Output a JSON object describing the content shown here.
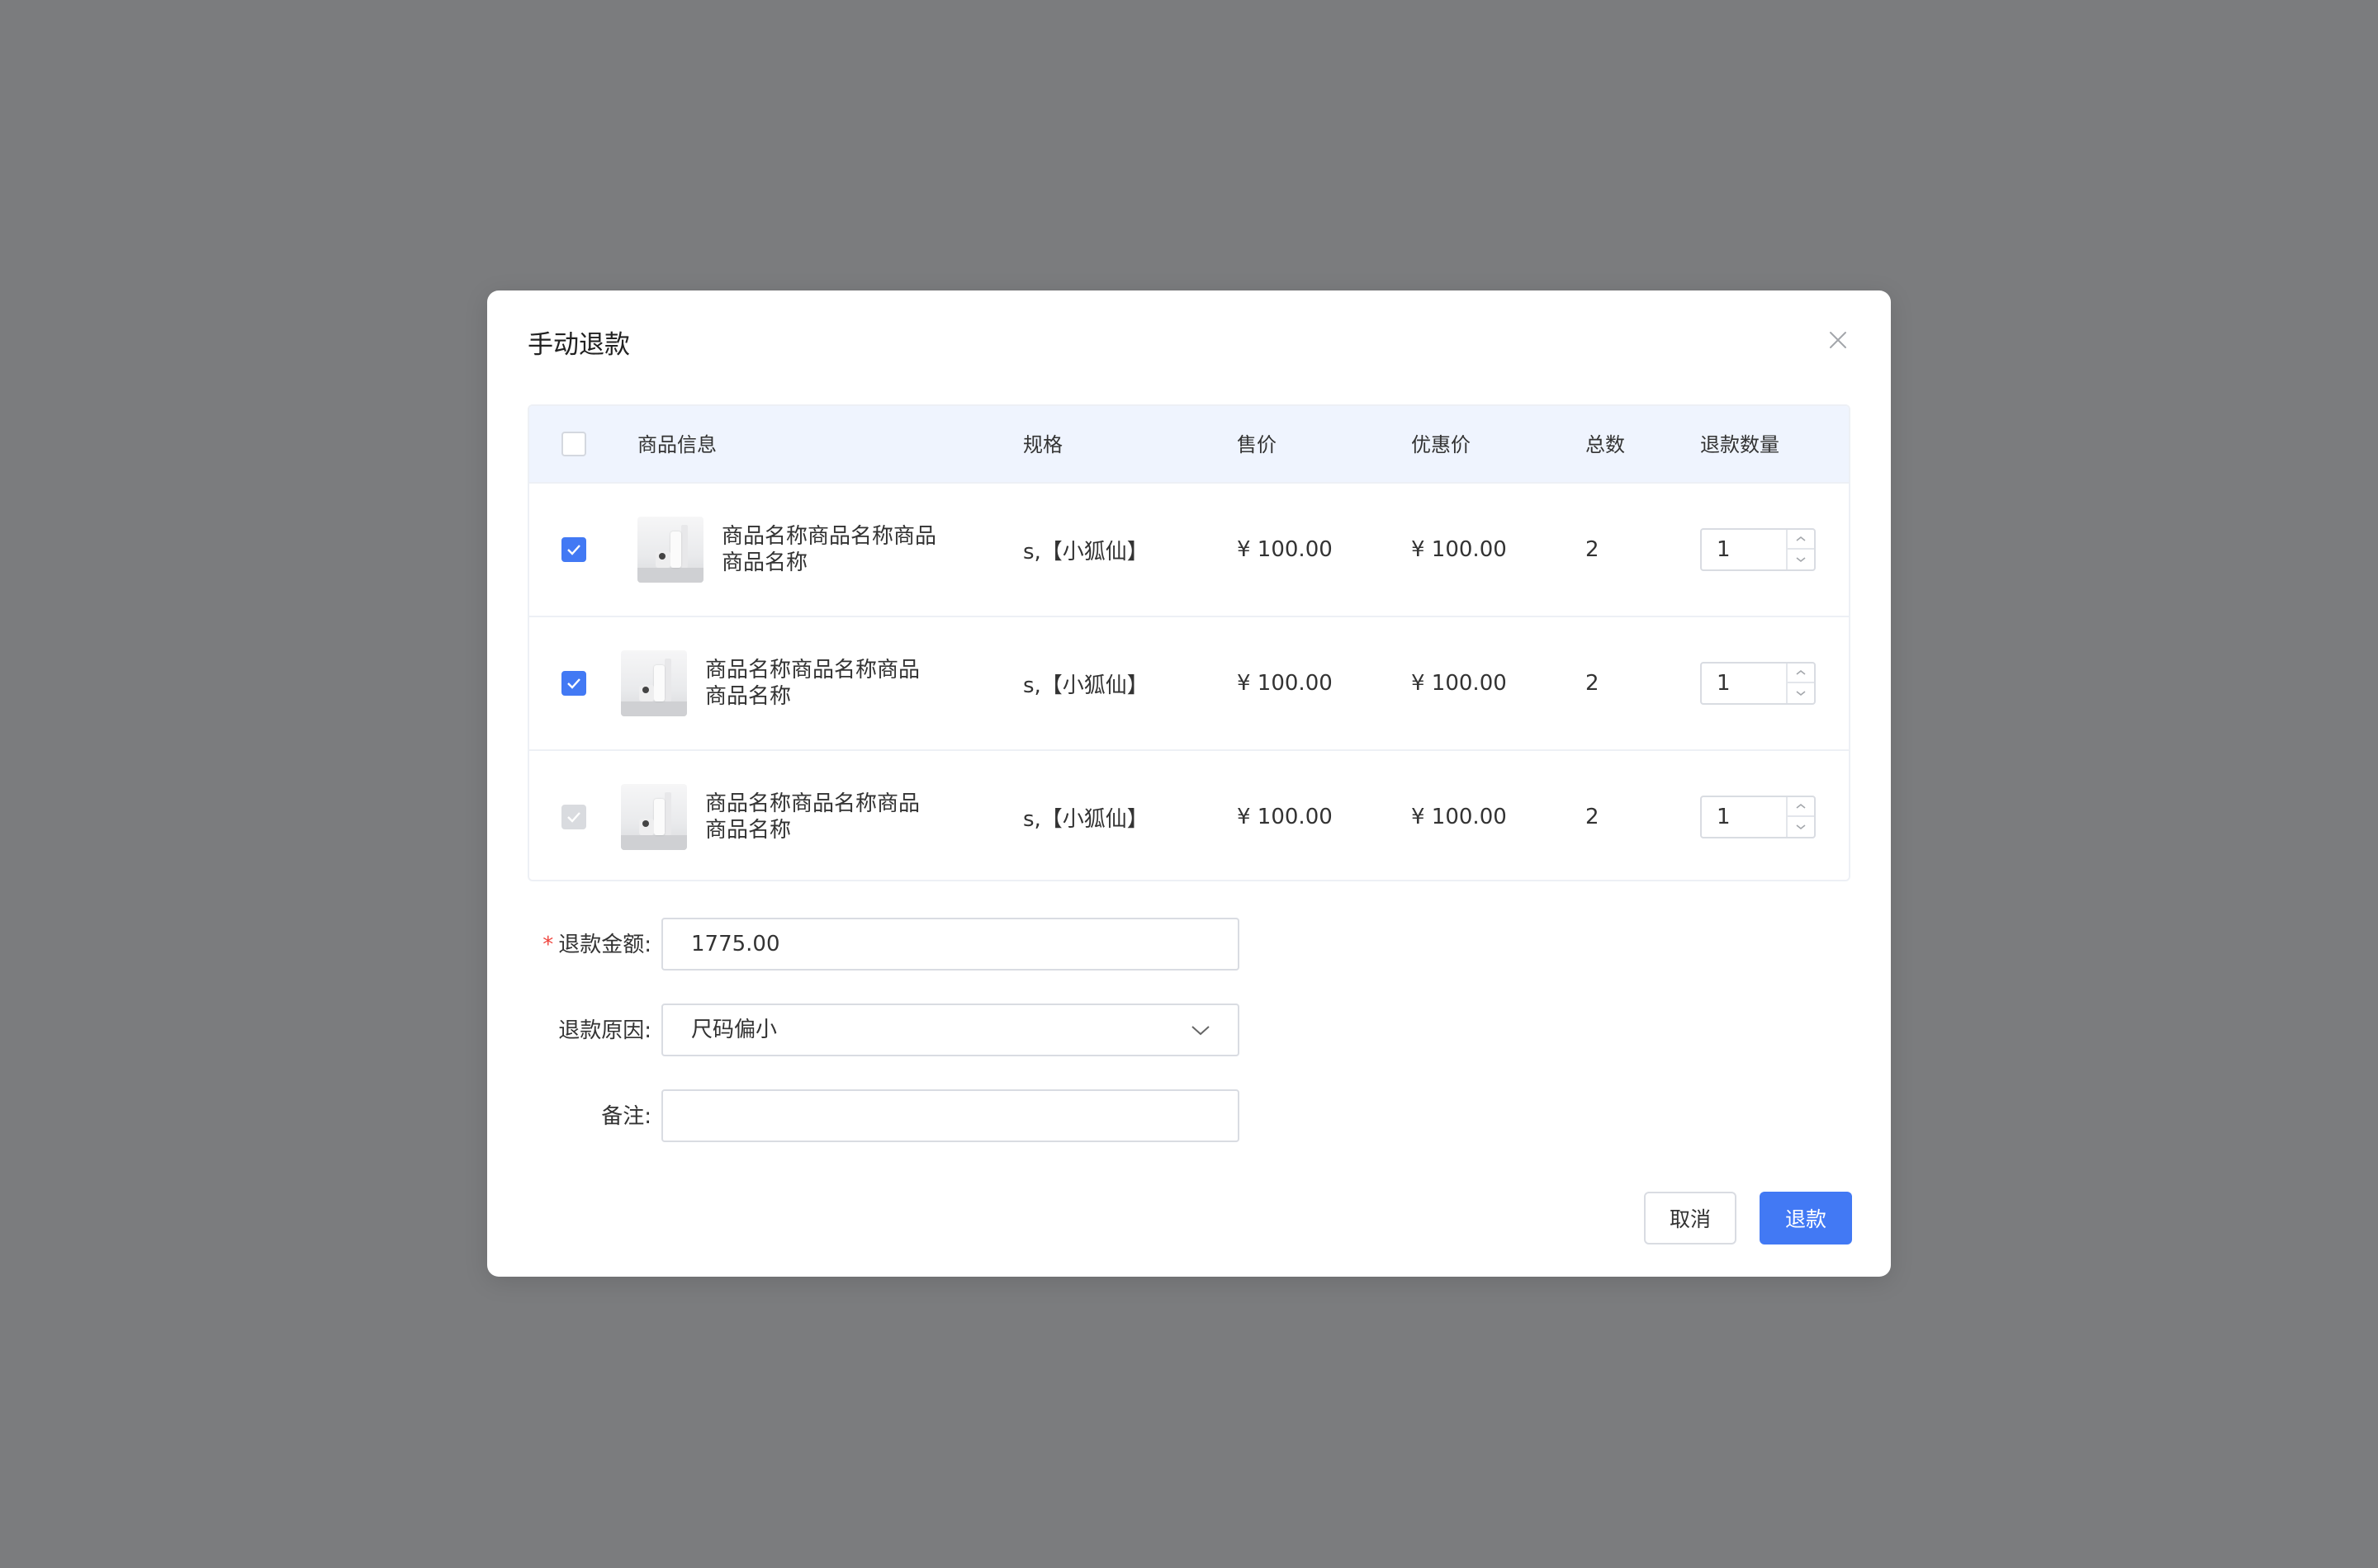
{
  "dialog": {
    "title": "手动退款"
  },
  "table": {
    "headers": {
      "product_info": "商品信息",
      "spec": "规格",
      "price": "售价",
      "discount_price": "优惠价",
      "total": "总数",
      "refund_qty": "退款数量"
    },
    "rows": [
      {
        "checked": true,
        "disabled": false,
        "name": "商品名称商品名称商品商品名称",
        "spec": "s,【小狐仙】",
        "price": "¥ 100.00",
        "discount_price": "¥ 100.00",
        "total": "2",
        "refund_qty": "1"
      },
      {
        "checked": true,
        "disabled": false,
        "name": "商品名称商品名称商品商品名称",
        "spec": "s,【小狐仙】",
        "price": "¥ 100.00",
        "discount_price": "¥ 100.00",
        "total": "2",
        "refund_qty": "1"
      },
      {
        "checked": true,
        "disabled": true,
        "name": "商品名称商品名称商品商品名称",
        "spec": "s,【小狐仙】",
        "price": "¥ 100.00",
        "discount_price": "¥ 100.00",
        "total": "2",
        "refund_qty": "1"
      }
    ]
  },
  "form": {
    "amount_label": "退款金额:",
    "amount_required_mark": "*",
    "amount_value": "1775.00",
    "reason_label": "退款原因:",
    "reason_value": "尺码偏小",
    "note_label": "备注:",
    "note_value": ""
  },
  "footer": {
    "cancel_label": "取消",
    "refund_label": "退款"
  },
  "colors": {
    "primary": "#4279f4",
    "overlay": "#7b7c7e",
    "header_bg": "#eff4fe",
    "required": "#f0463f"
  },
  "icons": {
    "close": "close-icon",
    "check": "check-icon",
    "chevron": "chevron-down-icon",
    "stepper_up": "chevron-up-icon",
    "stepper_down": "chevron-down-icon"
  }
}
